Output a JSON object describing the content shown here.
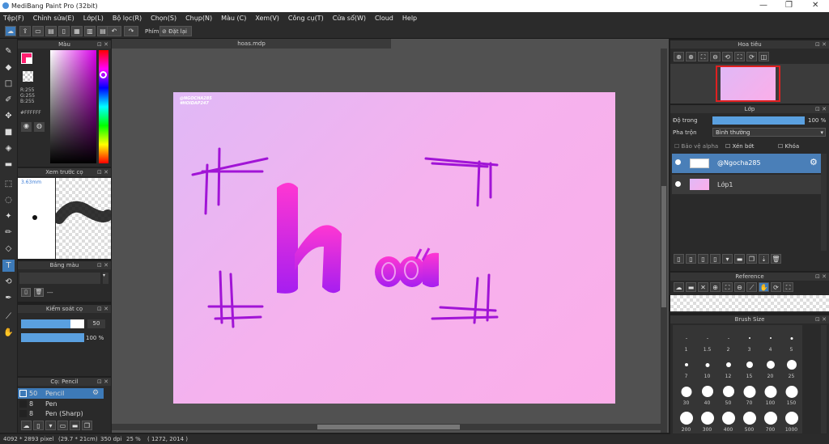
{
  "window": {
    "title": "MediBang Paint Pro (32bit)",
    "minimize": "—",
    "maximize": "❐",
    "close": "✕"
  },
  "menu": [
    "Tệp(F)",
    "Chỉnh sửa(E)",
    "Lớp(L)",
    "Bộ lọc(R)",
    "Chọn(S)",
    "Chụp(N)",
    "Màu (C)",
    "Xem(V)",
    "Công cụ(T)",
    "Cửa sổ(W)",
    "Cloud",
    "Help"
  ],
  "toolbar": {
    "shortcut_label": "Phím",
    "reset_label": "Đặt lại"
  },
  "color_panel": {
    "title": "Màu",
    "r": "R:255",
    "g": "G:255",
    "b": "B:255",
    "hex": "#FFFFFF",
    "foreground": "#ff1e6e",
    "background": "#ffffff"
  },
  "brush_preview": {
    "title": "Xem trước cọ",
    "size": "3.63mm"
  },
  "palette": {
    "title": "Bảng màu",
    "value": "---"
  },
  "brush_control": {
    "title": "Kiểm soát cọ",
    "size": "50",
    "opacity": "100 %",
    "size_fraction": 0.78,
    "opacity_fraction": 1.0
  },
  "brush_list": {
    "title": "Cọ: Pencil",
    "items": [
      {
        "size": "50",
        "name": "Pencil"
      },
      {
        "size": "8",
        "name": "Pen"
      },
      {
        "size": "8",
        "name": "Pen (Sharp)"
      }
    ]
  },
  "document": {
    "tab": "hoas.mdp",
    "watermark_line1": "@NGOCHA285",
    "watermark_line2": "#HOIDAP247",
    "text": "hoai"
  },
  "navigator": {
    "title": "Hoa tiêu"
  },
  "layers": {
    "title": "Lớp",
    "opacity_label": "Độ trong",
    "opacity_value": "100 %",
    "opacity_fraction": 1.0,
    "blend_label": "Pha trộn",
    "blend_value": "Bình thường",
    "protect_alpha": "Bảo vệ alpha",
    "clipping": "Xén bớt",
    "lock": "Khóa",
    "items": [
      {
        "name": "@Ngocha285",
        "selected": true
      },
      {
        "name": "Lớp1",
        "selected": false
      }
    ]
  },
  "reference": {
    "title": "Reference"
  },
  "brush_size": {
    "title": "Brush Size",
    "sizes": [
      "1",
      "1.5",
      "2",
      "3",
      "4",
      "5",
      "7",
      "10",
      "12",
      "15",
      "20",
      "25",
      "30",
      "40",
      "50",
      "70",
      "100",
      "150",
      "200",
      "300",
      "400",
      "500",
      "700",
      "1000"
    ]
  },
  "status": {
    "pixels": "4092 * 2893 pixel",
    "size": "(29.7 * 21cm)",
    "dpi": "350 dpi",
    "zoom": "25 %",
    "coords": "( 1272, 2014 )"
  }
}
